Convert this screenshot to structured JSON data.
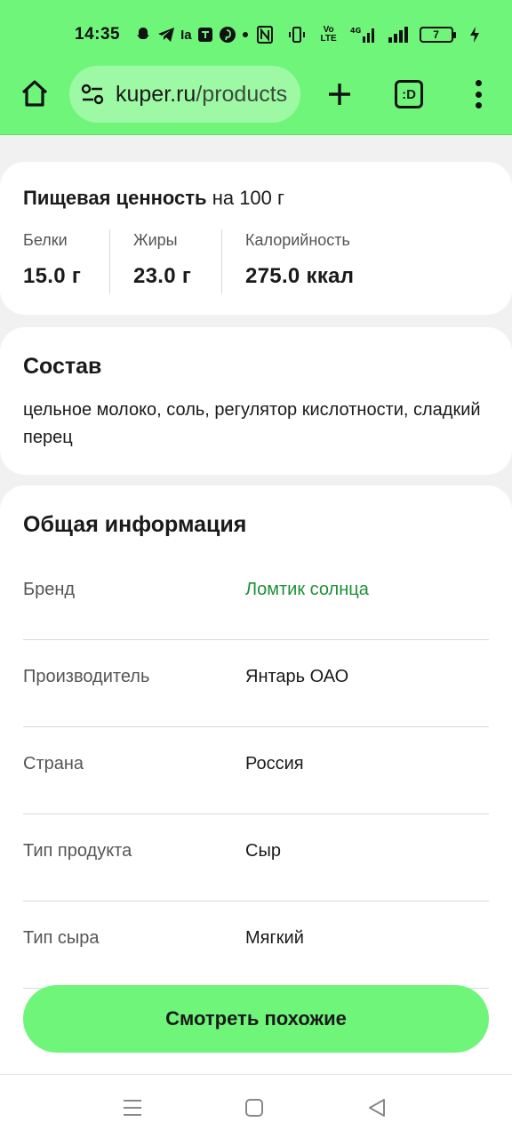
{
  "status_bar": {
    "time": "14:35",
    "battery": "7",
    "network": "4G"
  },
  "browser": {
    "url_host": "kuper.ru",
    "url_path": "/products",
    "tabs_label": ":D"
  },
  "nutrition": {
    "title_bold": "Пищевая ценность",
    "title_rest": " на 100 г",
    "items": [
      {
        "label": "Белки",
        "value": "15.0 г"
      },
      {
        "label": "Жиры",
        "value": "23.0 г"
      },
      {
        "label": "Калорийность",
        "value": "275.0 ккал"
      }
    ]
  },
  "composition": {
    "title": "Состав",
    "text": "цельное молоко, соль, регулятор кислотности, сладкий перец"
  },
  "general_info": {
    "title": "Общая информация",
    "rows": [
      {
        "key": "Бренд",
        "value": "Ломтик солнца"
      },
      {
        "key": "Производитель",
        "value": "Янтарь ОАО"
      },
      {
        "key": "Страна",
        "value": "Россия"
      },
      {
        "key": "Тип продукта",
        "value": "Сыр"
      },
      {
        "key": "Тип сыра",
        "value": "Мягкий"
      }
    ]
  },
  "cta": {
    "label": "Смотреть похожие"
  },
  "colors": {
    "accent": "#6ff57a",
    "link": "#1e8f37"
  },
  "icons": [
    "home-icon",
    "site-settings-icon",
    "plus-icon",
    "tabs-icon",
    "overflow-menu-icon",
    "recents-icon",
    "home-nav-icon",
    "back-icon"
  ]
}
